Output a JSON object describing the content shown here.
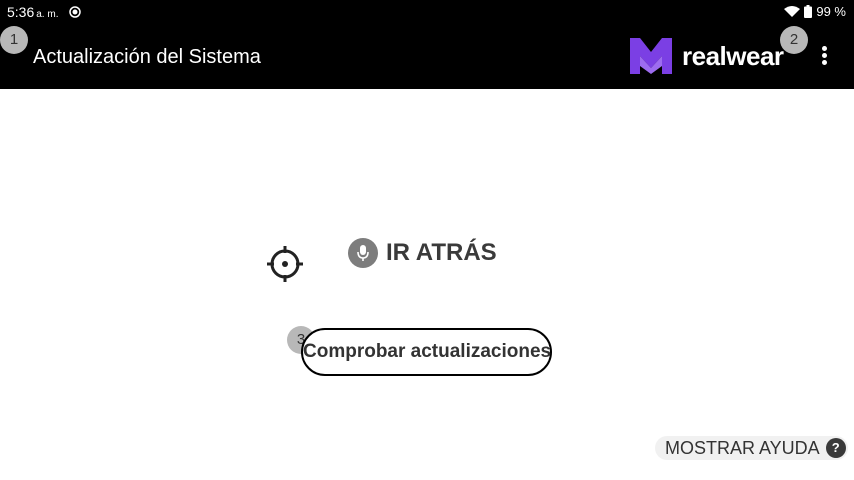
{
  "status_bar": {
    "time": "5:36",
    "ampm": "a. m.",
    "battery": "99 %"
  },
  "header": {
    "title": "Actualización del Sistema",
    "logo_text": "realwear"
  },
  "badges": [
    "1",
    "2",
    "3"
  ],
  "main": {
    "back_label": "IR ATRÁS",
    "check_button": "Comprobar actualizaciones"
  },
  "help": {
    "label": "MOSTRAR AYUDA",
    "icon_glyph": "?"
  },
  "colors": {
    "topbar": "#000000",
    "logo_purple": "#7b3fe4",
    "badge": "#b8b8b8"
  }
}
